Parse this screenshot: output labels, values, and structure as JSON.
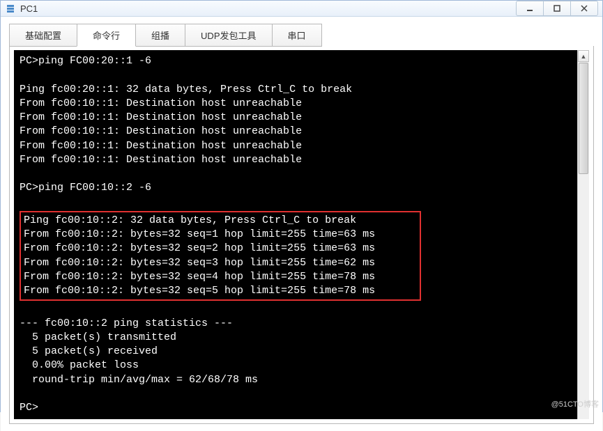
{
  "window": {
    "title": "PC1"
  },
  "tabs": [
    {
      "label": "基础配置"
    },
    {
      "label": "命令行"
    },
    {
      "label": "组播"
    },
    {
      "label": "UDP发包工具"
    },
    {
      "label": "串口"
    }
  ],
  "terminal": {
    "lines_before": [
      "PC>ping FC00:20::1 -6",
      "",
      "Ping fc00:20::1: 32 data bytes, Press Ctrl_C to break",
      "From fc00:10::1: Destination host unreachable",
      "From fc00:10::1: Destination host unreachable",
      "From fc00:10::1: Destination host unreachable",
      "From fc00:10::1: Destination host unreachable",
      "From fc00:10::1: Destination host unreachable",
      "",
      "PC>ping FC00:10::2 -6",
      ""
    ],
    "highlighted": [
      "Ping fc00:10::2: 32 data bytes, Press Ctrl_C to break",
      "From fc00:10::2: bytes=32 seq=1 hop limit=255 time=63 ms",
      "From fc00:10::2: bytes=32 seq=2 hop limit=255 time=63 ms",
      "From fc00:10::2: bytes=32 seq=3 hop limit=255 time=62 ms",
      "From fc00:10::2: bytes=32 seq=4 hop limit=255 time=78 ms",
      "From fc00:10::2: bytes=32 seq=5 hop limit=255 time=78 ms"
    ],
    "lines_after": [
      "",
      "--- fc00:10::2 ping statistics ---",
      "  5 packet(s) transmitted",
      "  5 packet(s) received",
      "  0.00% packet loss",
      "  round-trip min/avg/max = 62/68/78 ms",
      "",
      "PC>"
    ]
  },
  "watermark": "@51CTO博客"
}
